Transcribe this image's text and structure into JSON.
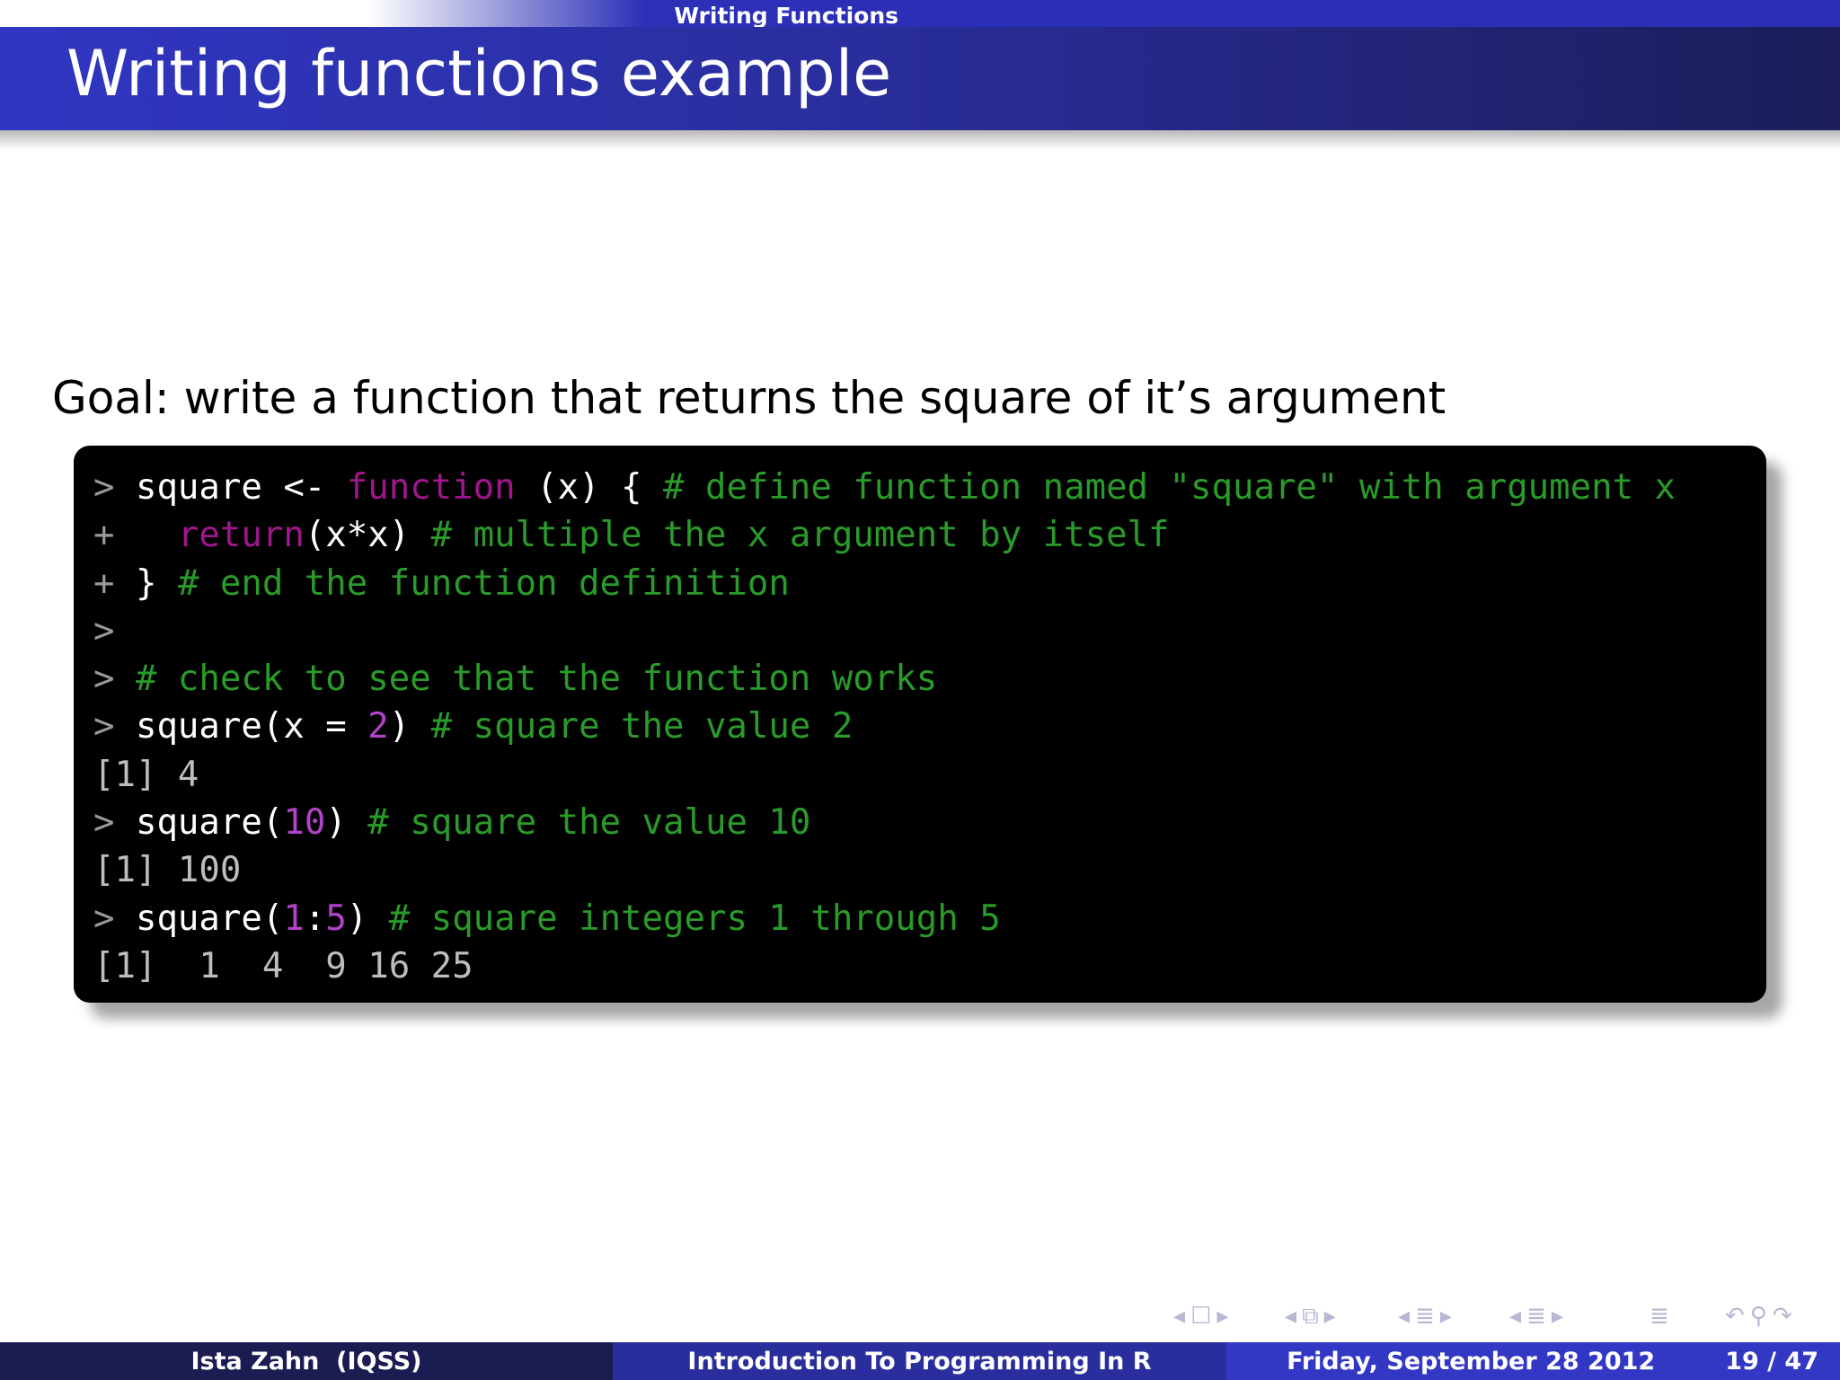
{
  "header": {
    "section": "Writing Functions",
    "frametitle": "Writing functions example"
  },
  "body": {
    "goal": "Goal: write a function that returns the square of it’s argument",
    "code_lines": [
      [
        {
          "t": "> ",
          "c": "prompt"
        },
        {
          "t": "square <- ",
          "c": "code"
        },
        {
          "t": "function",
          "c": "kw"
        },
        {
          "t": " (x) { ",
          "c": "code"
        },
        {
          "t": "# define function named \"square\" with argument x",
          "c": "cmt"
        }
      ],
      [
        {
          "t": "+   ",
          "c": "prompt"
        },
        {
          "t": "return",
          "c": "kw"
        },
        {
          "t": "(x*x) ",
          "c": "code"
        },
        {
          "t": "# multiple the x argument by itself",
          "c": "cmt"
        }
      ],
      [
        {
          "t": "+ ",
          "c": "prompt"
        },
        {
          "t": "} ",
          "c": "code"
        },
        {
          "t": "# end the function definition",
          "c": "cmt"
        }
      ],
      [
        {
          "t": ">",
          "c": "prompt"
        }
      ],
      [
        {
          "t": "> ",
          "c": "prompt"
        },
        {
          "t": "# check to see that the function works",
          "c": "cmt"
        }
      ],
      [
        {
          "t": "> ",
          "c": "prompt"
        },
        {
          "t": "square(x = ",
          "c": "code"
        },
        {
          "t": "2",
          "c": "num"
        },
        {
          "t": ") ",
          "c": "code"
        },
        {
          "t": "# square the value 2",
          "c": "cmt"
        }
      ],
      [
        {
          "t": "[1] 4",
          "c": "out"
        }
      ],
      [
        {
          "t": "> ",
          "c": "prompt"
        },
        {
          "t": "square(",
          "c": "code"
        },
        {
          "t": "10",
          "c": "num"
        },
        {
          "t": ") ",
          "c": "code"
        },
        {
          "t": "# square the value 10",
          "c": "cmt"
        }
      ],
      [
        {
          "t": "[1] 100",
          "c": "out"
        }
      ],
      [
        {
          "t": "> ",
          "c": "prompt"
        },
        {
          "t": "square(",
          "c": "code"
        },
        {
          "t": "1",
          "c": "num"
        },
        {
          "t": ":",
          "c": "code"
        },
        {
          "t": "5",
          "c": "num"
        },
        {
          "t": ") ",
          "c": "code"
        },
        {
          "t": "# square integers 1 through 5",
          "c": "cmt"
        }
      ],
      [
        {
          "t": "[1]  1  4  9 16 25",
          "c": "out"
        }
      ]
    ]
  },
  "navigation": {
    "icons": [
      "slide-nav-left-icon",
      "slide-icon",
      "slide-nav-right-icon",
      "frame-nav-left-icon",
      "frame-icon",
      "frame-nav-right-icon",
      "subsection-nav-left-icon",
      "subsection-icon",
      "subsection-nav-right-icon",
      "section-nav-left-icon",
      "section-icon",
      "section-nav-right-icon",
      "document-icon",
      "back-icon",
      "search-icon",
      "forward-icon"
    ]
  },
  "footer": {
    "author": "Ista Zahn  (IQSS)",
    "title": "Introduction To Programming In R",
    "date": "Friday, September 28 2012",
    "page": "19 / 47"
  },
  "colors": {
    "header_blue": "#2b2fb5",
    "code_background": "#000000",
    "comment_green": "#2a9b2a",
    "keyword_purple": "#a0168c",
    "number_purple": "#b043c8",
    "prompt_gray": "#9a9a9a"
  }
}
